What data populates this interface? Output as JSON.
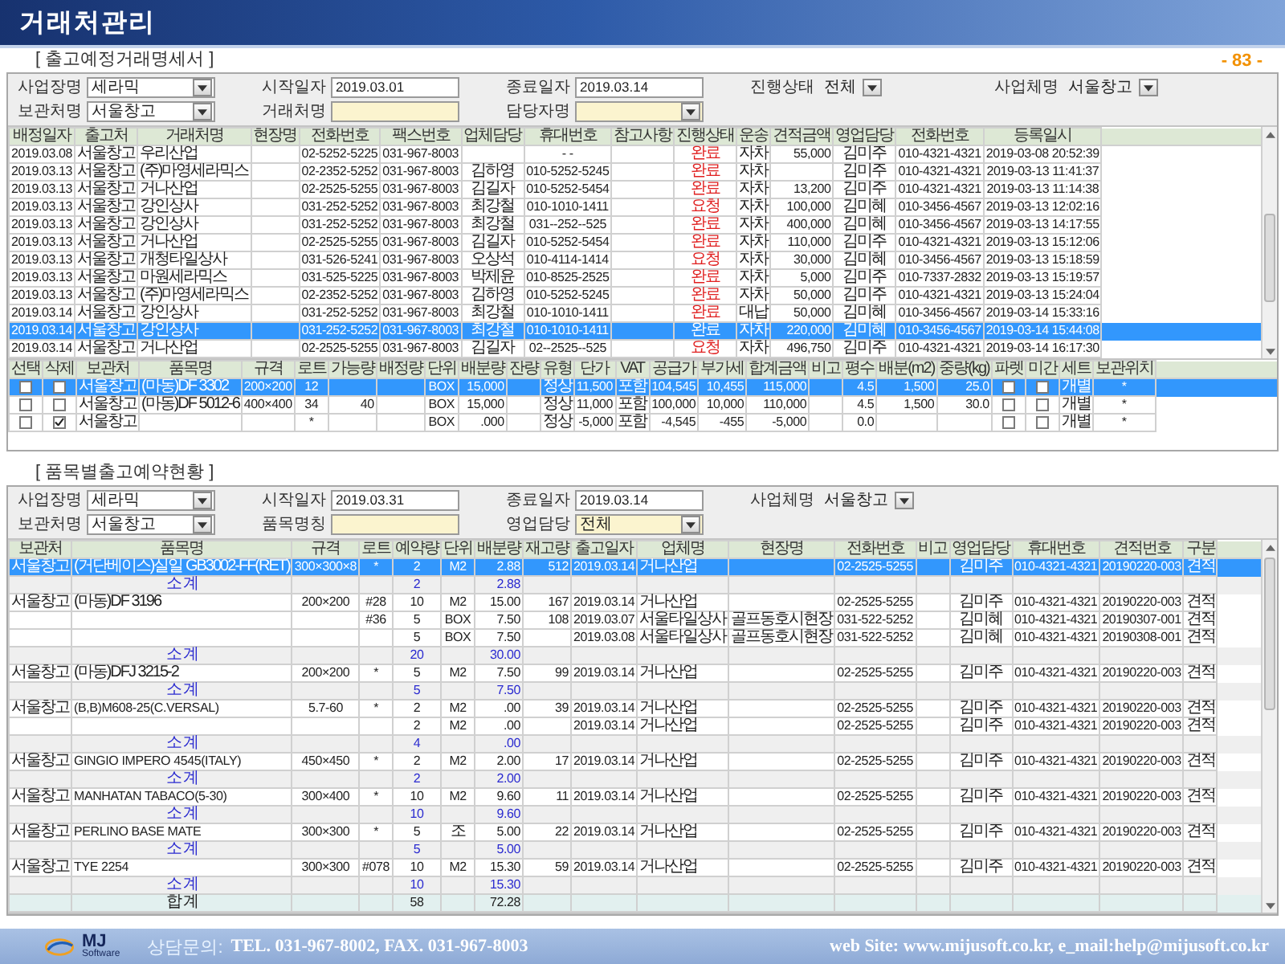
{
  "header": {
    "title": "거래처관리",
    "page_number": "- 83 -"
  },
  "shipment_statement": {
    "title": "[ 출고예정거래명세서 ]",
    "filters": [
      [
        {
          "label": "사업장명",
          "value": "세라믹",
          "kind": "select",
          "highlighted": false
        },
        {
          "label": "시작일자",
          "value": "2019.03.01",
          "kind": "field",
          "highlighted": false
        },
        {
          "label": "종료일자",
          "value": "2019.03.14",
          "kind": "field",
          "highlighted": false
        },
        {
          "label": "진행상태",
          "value": "전체",
          "kind": "flat_select",
          "highlighted": false
        },
        {
          "label": "사업체명",
          "value": "서울창고",
          "kind": "flat_select",
          "highlighted": false
        }
      ],
      [
        {
          "label": "보관처명",
          "value": "서울창고",
          "kind": "select",
          "highlighted": false
        },
        {
          "label": "거래처명",
          "kind": "field",
          "highlighted": true
        },
        {
          "label": "담당자명",
          "kind": "select",
          "highlighted": true
        }
      ]
    ],
    "table": {
      "columns": [
        "배정일자",
        "출고처",
        "거래처명",
        "현장명",
        "전화번호",
        "팩스번호",
        "업체담당",
        "휴대번호",
        "참고사항",
        "진행상태",
        "운송",
        "견적금액",
        "영업담당",
        "전화번호",
        "등록일시"
      ],
      "rows": [
        {
          "selected": false,
          "cells": [
            "2019.03.08",
            "서울창고",
            "우리산업",
            null,
            "02-5252-5225",
            "031-967-8003",
            null,
            "- -",
            null,
            "완료",
            "자차",
            "55,000",
            "김미주",
            "010-4321-4321",
            "2019-03-08 20:52:39"
          ]
        },
        {
          "selected": false,
          "cells": [
            "2019.03.13",
            "서울창고",
            "(주)마영세라믹스",
            null,
            "02-2352-5252",
            "031-967-8003",
            "김하영",
            "010-5252-5245",
            null,
            "완료",
            "자차",
            null,
            "김미주",
            "010-4321-4321",
            "2019-03-13 11:41:37"
          ]
        },
        {
          "selected": false,
          "cells": [
            "2019.03.13",
            "서울창고",
            "거나산업",
            null,
            "02-2525-5255",
            "031-967-8003",
            "김길자",
            "010-5252-5454",
            null,
            "완료",
            "자차",
            "13,200",
            "김미주",
            "010-4321-4321",
            "2019-03-13 11:14:38"
          ]
        },
        {
          "selected": false,
          "cells": [
            "2019.03.13",
            "서울창고",
            "강인상사",
            null,
            "031-252-5252",
            "031-967-8003",
            "최강철",
            "010-1010-1411",
            null,
            "요청",
            "자차",
            "100,000",
            "김미혜",
            "010-3456-4567",
            "2019-03-13 12:02:16"
          ]
        },
        {
          "selected": false,
          "cells": [
            "2019.03.13",
            "서울창고",
            "강인상사",
            null,
            "031-252-5252",
            "031-967-8003",
            "최강철",
            "031--252--525",
            null,
            "완료",
            "자차",
            "400,000",
            "김미혜",
            "010-3456-4567",
            "2019-03-13 14:17:55"
          ]
        },
        {
          "selected": false,
          "cells": [
            "2019.03.13",
            "서울창고",
            "거나산업",
            null,
            "02-2525-5255",
            "031-967-8003",
            "김길자",
            "010-5252-5454",
            null,
            "완료",
            "자차",
            "110,000",
            "김미주",
            "010-4321-4321",
            "2019-03-13 15:12:06"
          ]
        },
        {
          "selected": false,
          "cells": [
            "2019.03.13",
            "서울창고",
            "개청타일상사",
            null,
            "031-526-5241",
            "031-967-8003",
            "오상석",
            "010-4114-1414",
            null,
            "요청",
            "자차",
            "30,000",
            "김미혜",
            "010-3456-4567",
            "2019-03-13 15:18:59"
          ]
        },
        {
          "selected": false,
          "cells": [
            "2019.03.13",
            "서울창고",
            "마원세라믹스",
            null,
            "031-525-5225",
            "031-967-8003",
            "박제윤",
            "010-8525-2525",
            null,
            "완료",
            "자차",
            "5,000",
            "김미주",
            "010-7337-2832",
            "2019-03-13 15:19:57"
          ]
        },
        {
          "selected": false,
          "cells": [
            "2019.03.13",
            "서울창고",
            "(주)마영세라믹스",
            null,
            "02-2352-5252",
            "031-967-8003",
            "김하영",
            "010-5252-5245",
            null,
            "완료",
            "자차",
            "50,000",
            "김미주",
            "010-4321-4321",
            "2019-03-13 15:24:04"
          ]
        },
        {
          "selected": false,
          "cells": [
            "2019.03.14",
            "서울창고",
            "강인상사",
            null,
            "031-252-5252",
            "031-967-8003",
            "최강철",
            "010-1010-1411",
            null,
            "완료",
            "대납",
            "50,000",
            "김미혜",
            "010-3456-4567",
            "2019-03-14 15:33:16"
          ]
        },
        {
          "selected": true,
          "cells": [
            "2019.03.14",
            "서울창고",
            "강인상사",
            null,
            "031-252-5252",
            "031-967-8003",
            "최강철",
            "010-1010-1411",
            null,
            "완료",
            "자차",
            "220,000",
            "김미혜",
            "010-3456-4567",
            "2019-03-14 15:44:08"
          ]
        },
        {
          "selected": false,
          "cells": [
            "2019.03.14",
            "서울창고",
            "거나산업",
            null,
            "02-2525-5255",
            "031-967-8003",
            "김길자",
            "02--2525--525",
            null,
            "요청",
            "자차",
            "496,750",
            "김미주",
            "010-4321-4321",
            "2019-03-14 16:17:30"
          ]
        }
      ]
    },
    "detail_table": {
      "columns": [
        "선택",
        "삭제",
        "보관처",
        "품목명",
        "규격",
        "로트",
        "가능량",
        "배정량",
        "단위",
        "배분량",
        "잔량",
        "유형",
        "단가",
        "VAT",
        "공급가",
        "부가세",
        "합계금액",
        "비고",
        "평수",
        "배분(m2)",
        "중량(kg)",
        "파렛",
        "미간",
        "세트",
        "보관위치"
      ],
      "rows": [
        {
          "selected": true,
          "cells": [
            {
              "kind": "checkbox",
              "checked": false
            },
            {
              "kind": "checkbox",
              "checked": false
            },
            "서울창고",
            "(마동)DF 3302",
            "200×200",
            "12",
            null,
            null,
            "BOX",
            "15,000",
            null,
            "정상",
            "11,500",
            "포함",
            "104,545",
            "10,455",
            "115,000",
            null,
            "4.5",
            "1,500",
            "25.0",
            {
              "kind": "checkbox",
              "checked": false
            },
            {
              "kind": "checkbox",
              "checked": false
            },
            "개별",
            "*"
          ]
        },
        {
          "selected": false,
          "cells": [
            {
              "kind": "checkbox",
              "checked": false
            },
            {
              "kind": "checkbox",
              "checked": false
            },
            "서울창고",
            "(마동)DF 5012-6",
            "400×400",
            "34",
            "40",
            null,
            "BOX",
            "15,000",
            null,
            "정상",
            "11,000",
            "포함",
            "100,000",
            "10,000",
            "110,000",
            null,
            "4.5",
            "1,500",
            "30.0",
            {
              "kind": "checkbox",
              "checked": false
            },
            {
              "kind": "checkbox",
              "checked": false
            },
            "개별",
            "*"
          ]
        },
        {
          "selected": false,
          "cells": [
            {
              "kind": "checkbox",
              "checked": false
            },
            {
              "kind": "checkbox",
              "checked": true
            },
            "서울창고",
            null,
            null,
            "*",
            null,
            null,
            "BOX",
            ".000",
            null,
            "정상",
            "-5,000",
            "포함",
            "-4,545",
            "-455",
            "-5,000",
            null,
            "0.0",
            null,
            null,
            {
              "kind": "checkbox",
              "checked": false
            },
            {
              "kind": "checkbox",
              "checked": false
            },
            "개별",
            "*"
          ]
        }
      ]
    }
  },
  "reservation_status": {
    "title": "[ 품목별출고예약현황 ]",
    "filters": [
      [
        {
          "label": "사업장명",
          "value": "세라믹",
          "kind": "select",
          "highlighted": false
        },
        {
          "label": "시작일자",
          "value": "2019.03.31",
          "kind": "field",
          "highlighted": false
        },
        {
          "label": "종료일자",
          "value": "2019.03.14",
          "kind": "field",
          "highlighted": false
        },
        {
          "label": "사업체명",
          "value": "서울창고",
          "kind": "flat_select",
          "highlighted": false
        }
      ],
      [
        {
          "label": "보관처명",
          "value": "서울창고",
          "kind": "select",
          "highlighted": false
        },
        {
          "label": "품목명칭",
          "kind": "field",
          "highlighted": true
        },
        {
          "label": "영업담당",
          "value": "전체",
          "kind": "select",
          "highlighted": true
        }
      ]
    ],
    "table": {
      "columns": [
        "보관처",
        "품목명",
        "규격",
        "로트",
        "예약량",
        "단위",
        "배분량",
        "재고량",
        "출고일자",
        "업체명",
        "현장명",
        "전화번호",
        "비고",
        "영업담당",
        "휴대번호",
        "견적번호",
        "구분"
      ],
      "rows": [
        {
          "kind": "item",
          "selected": true,
          "cells": [
            "서울창고",
            "(거단베이스)실일 GB3002-FF(RET)",
            "300×300×8",
            "*",
            "2",
            "M2",
            "2.88",
            "512",
            "2019.03.14",
            "거나산업",
            null,
            "02-2525-5255",
            null,
            "김미주",
            "010-4321-4321",
            "20190220-003",
            "견적"
          ]
        },
        {
          "kind": "subtotal",
          "selected": false,
          "label": "소 계",
          "quantity": "2",
          "amount": "2.88"
        },
        {
          "kind": "item",
          "selected": false,
          "cells": [
            "서울창고",
            "(마동)DF 3196",
            "200×200",
            "#28",
            "10",
            "M2",
            "15.00",
            "167",
            "2019.03.14",
            "거나산업",
            null,
            "02-2525-5255",
            null,
            "김미주",
            "010-4321-4321",
            "20190220-003",
            "견적"
          ]
        },
        {
          "kind": "item",
          "selected": false,
          "cells": [
            null,
            null,
            null,
            "#36",
            "5",
            "BOX",
            "7.50",
            "108",
            "2019.03.07",
            "서울타일상사",
            "골프동호시현장",
            "031-522-5252",
            null,
            "김미혜",
            "010-4321-4321",
            "20190307-001",
            "견적"
          ]
        },
        {
          "kind": "item",
          "selected": false,
          "cells": [
            null,
            null,
            null,
            null,
            "5",
            "BOX",
            "7.50",
            null,
            "2019.03.08",
            "서울타일상사",
            "골프동호시현장",
            "031-522-5252",
            null,
            "김미혜",
            "010-4321-4321",
            "20190308-001",
            "견적"
          ]
        },
        {
          "kind": "subtotal",
          "selected": false,
          "label": "소 계",
          "quantity": "20",
          "amount": "30.00"
        },
        {
          "kind": "item",
          "selected": false,
          "cells": [
            "서울창고",
            "(마동)DFJ 3215-2",
            "200×200",
            "*",
            "5",
            "M2",
            "7.50",
            "99",
            "2019.03.14",
            "거나산업",
            null,
            "02-2525-5255",
            null,
            "김미주",
            "010-4321-4321",
            "20190220-003",
            "견적"
          ]
        },
        {
          "kind": "subtotal",
          "selected": false,
          "label": "소 계",
          "quantity": "5",
          "amount": "7.50"
        },
        {
          "kind": "item",
          "selected": false,
          "cells": [
            "서울창고",
            "(B,B)M608-25(C.VERSAL)",
            "5.7-60",
            "*",
            "2",
            "M2",
            ".00",
            "39",
            "2019.03.14",
            "거나산업",
            null,
            "02-2525-5255",
            null,
            "김미주",
            "010-4321-4321",
            "20190220-003",
            "견적"
          ]
        },
        {
          "kind": "item",
          "selected": false,
          "cells": [
            null,
            null,
            null,
            null,
            "2",
            "M2",
            ".00",
            null,
            "2019.03.14",
            "거나산업",
            null,
            "02-2525-5255",
            null,
            "김미주",
            "010-4321-4321",
            "20190220-003",
            "견적"
          ]
        },
        {
          "kind": "subtotal",
          "selected": false,
          "label": "소 계",
          "quantity": "4",
          "amount": ".00"
        },
        {
          "kind": "item",
          "selected": false,
          "cells": [
            "서울창고",
            "GINGIO IMPERO 4545(ITALY)",
            "450×450",
            "*",
            "2",
            "M2",
            "2.00",
            "17",
            "2019.03.14",
            "거나산업",
            null,
            "02-2525-5255",
            null,
            "김미주",
            "010-4321-4321",
            "20190220-003",
            "견적"
          ]
        },
        {
          "kind": "subtotal",
          "selected": false,
          "label": "소 계",
          "quantity": "2",
          "amount": "2.00"
        },
        {
          "kind": "item",
          "selected": false,
          "cells": [
            "서울창고",
            "MANHATAN TABACO(5-30)",
            "300×400",
            "*",
            "10",
            "M2",
            "9.60",
            "11",
            "2019.03.14",
            "거나산업",
            null,
            "02-2525-5255",
            null,
            "김미주",
            "010-4321-4321",
            "20190220-003",
            "견적"
          ]
        },
        {
          "kind": "subtotal",
          "selected": false,
          "label": "소 계",
          "quantity": "10",
          "amount": "9.60"
        },
        {
          "kind": "item",
          "selected": false,
          "cells": [
            "서울창고",
            "PERLINO BASE MATE",
            "300×300",
            "*",
            "5",
            "조",
            "5.00",
            "22",
            "2019.03.14",
            "거나산업",
            null,
            "02-2525-5255",
            null,
            "김미주",
            "010-4321-4321",
            "20190220-003",
            "견적"
          ]
        },
        {
          "kind": "subtotal",
          "selected": false,
          "label": "소 계",
          "quantity": "5",
          "amount": "5.00"
        },
        {
          "kind": "item",
          "selected": false,
          "cells": [
            "서울창고",
            "TYE 2254",
            "300×300",
            "#078",
            "10",
            "M2",
            "15.30",
            "59",
            "2019.03.14",
            "거나산업",
            null,
            "02-2525-5255",
            null,
            "김미주",
            "010-4321-4321",
            "20190220-003",
            "견적"
          ]
        },
        {
          "kind": "subtotal",
          "selected": false,
          "label": "소 계",
          "quantity": "10",
          "amount": "15.30"
        },
        {
          "kind": "total",
          "selected": false,
          "label": "합 계",
          "quantity": "58",
          "amount": "72.28"
        }
      ]
    }
  },
  "footer": {
    "logo": {
      "name": "MJ",
      "tagline": "Software"
    },
    "contact_label": "상담문의:",
    "contact": "TEL. 031-967-8002, FAX. 031-967-8003",
    "web": "web Site: www.mijusoft.co.kr, e_mail:help@mijusoft.co.kr"
  }
}
